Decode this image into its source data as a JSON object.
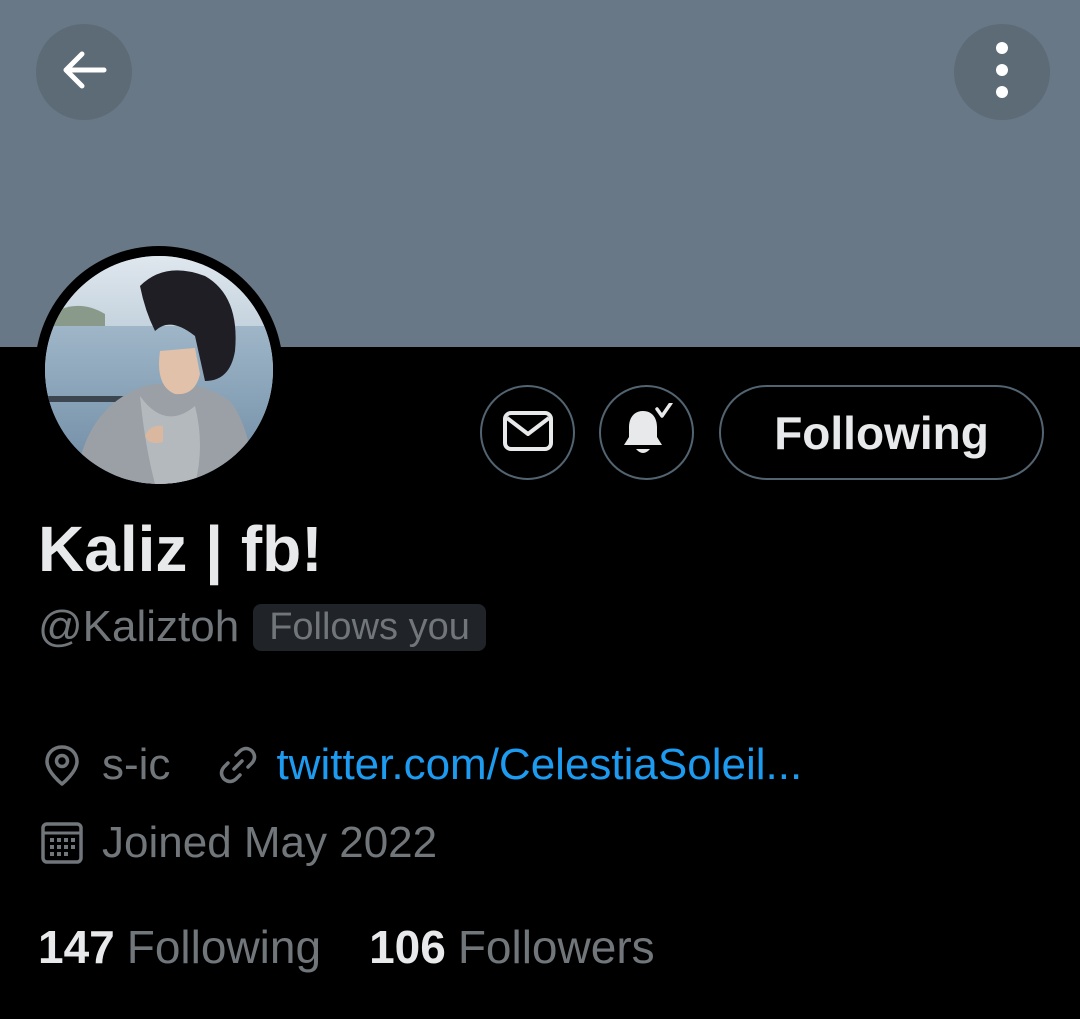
{
  "header": {
    "back_icon": "arrow-left-icon",
    "more_icon": "more-vertical-icon",
    "banner_color": "#687886"
  },
  "profile": {
    "display_name": "Kaliz | fb!",
    "handle": "@Kaliztoh",
    "follows_you_badge": "Follows you"
  },
  "actions": {
    "message_icon": "mail-icon",
    "notify_icon": "bell-check-icon",
    "follow_button_label": "Following"
  },
  "meta": {
    "location": "s-ic",
    "website": "twitter.com/CelestiaSoleil...",
    "joined": "Joined May 2022"
  },
  "stats": {
    "following_count": "147",
    "following_label": "Following",
    "followers_count": "106",
    "followers_label": "Followers"
  },
  "colors": {
    "text_primary": "#e7e9ea",
    "text_secondary": "#71767b",
    "link": "#1d9bf0",
    "border": "#536471"
  }
}
